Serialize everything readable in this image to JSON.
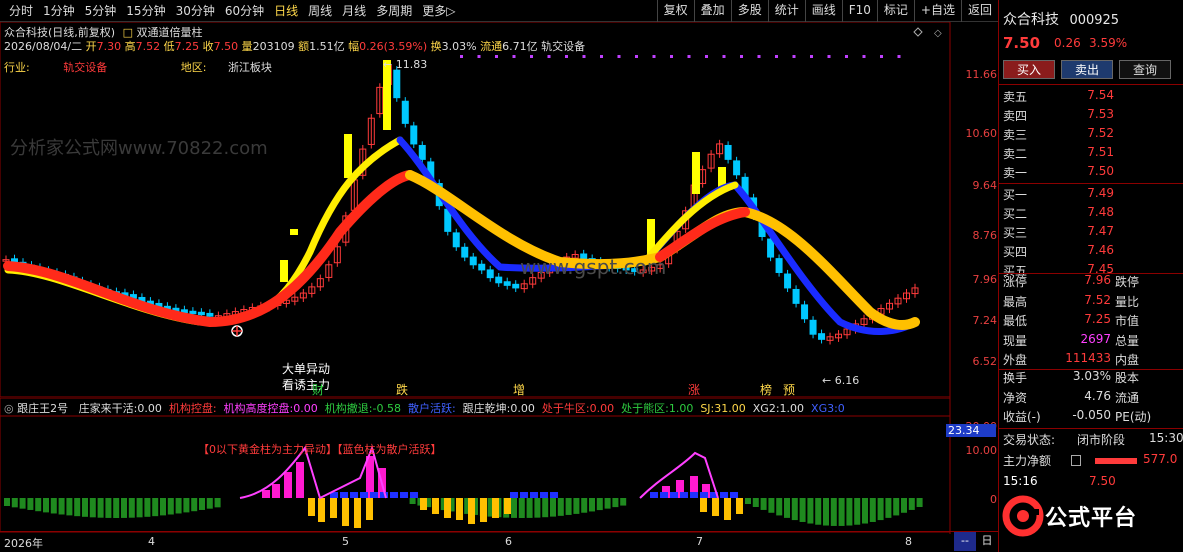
{
  "toolbar": {
    "periods": [
      "分时",
      "1分钟",
      "5分钟",
      "15分钟",
      "30分钟",
      "60分钟",
      "日线",
      "周线",
      "月线",
      "多周期",
      "更多▷"
    ],
    "active_period": "日线",
    "buttons": [
      "复权",
      "叠加",
      "多股",
      "统计",
      "画线",
      "F10",
      "标记",
      "+自选",
      "返回"
    ]
  },
  "main_info": {
    "stock_label": "众合科技(日线,前复权)",
    "indicator_label": "双通道倍量柱",
    "date": "2026/08/04/二",
    "open_lbl": "开",
    "open": "7.30",
    "high_lbl": "高",
    "high": "7.52",
    "low_lbl": "低",
    "low": "7.25",
    "close_lbl": "收",
    "close": "7.50",
    "vol_lbl": "量",
    "vol": "203109",
    "amt_lbl": "额",
    "amt": "1.51亿",
    "amp_lbl": "幅",
    "amp": "0.26(3.59%)",
    "turn_lbl": "换",
    "turn": "3.03%",
    "float_lbl": "流通",
    "float": "6.71亿",
    "sector": "轨交设备",
    "industry_lbl": "行业:",
    "industry": "轨交设备",
    "region_lbl": "地区:",
    "region": "浙江板块"
  },
  "price_ticks": [
    "11.66",
    "10.60",
    "9.64",
    "8.76",
    "7.96",
    "7.24",
    "6.52"
  ],
  "annotations": {
    "high_mark": "11.83",
    "low_mark": "6.16",
    "big_order": "大单异动",
    "lure": "看诱主力",
    "labels": [
      "财",
      "跌",
      "增",
      "涨",
      "榜",
      "预"
    ]
  },
  "sub_info": {
    "name": "跟庄王2号",
    "items": [
      {
        "k": "庄家来干活:",
        "v": "0.00",
        "color": "#dddddd"
      },
      {
        "k": "机构控盘:",
        "v": "",
        "color": "#ff3b3b"
      },
      {
        "k": "机构高度控盘:",
        "v": "0.00",
        "color": "#ff40ff"
      },
      {
        "k": "机构撤退:",
        "v": "-0.58",
        "color": "#2ecc40"
      },
      {
        "k": "散户活跃:",
        "v": "",
        "color": "#4060ff"
      },
      {
        "k": "跟庄乾坤:",
        "v": "0.00",
        "color": "#dddddd"
      },
      {
        "k": "处于牛区:",
        "v": "0.00",
        "color": "#ff3b3b"
      },
      {
        "k": "处于熊区:",
        "v": "1.00",
        "color": "#2ecc40"
      },
      {
        "k": "SJ:",
        "v": "31.00",
        "color": "#ffd84a"
      },
      {
        "k": "XG2:",
        "v": "1.00",
        "color": "#dddddd"
      },
      {
        "k": "XG3:",
        "v": "0",
        "color": "#4060ff"
      }
    ],
    "note": "【0以下黄金柱为主力异动】【蓝色柱为散户活跃】",
    "ticks": [
      "20.00",
      "10.00",
      "0"
    ],
    "current": "23.34"
  },
  "date_axis": {
    "labels": [
      "2026年",
      "4",
      "5",
      "6",
      "7",
      "8"
    ],
    "right_btns": [
      "--",
      "日"
    ]
  },
  "panel": {
    "name": "众合科技",
    "code": "000925",
    "price": "7.50",
    "change": "0.26",
    "pct": "3.59%",
    "buttons": {
      "buy": "买入",
      "sell": "卖出",
      "query": "查询"
    },
    "asks": [
      {
        "label": "卖五",
        "price": "7.54"
      },
      {
        "label": "卖四",
        "price": "7.53"
      },
      {
        "label": "卖三",
        "price": "7.52"
      },
      {
        "label": "卖二",
        "price": "7.51"
      },
      {
        "label": "卖一",
        "price": "7.50"
      }
    ],
    "bids": [
      {
        "label": "买一",
        "price": "7.49"
      },
      {
        "label": "买二",
        "price": "7.48"
      },
      {
        "label": "买三",
        "price": "7.47"
      },
      {
        "label": "买四",
        "price": "7.46"
      },
      {
        "label": "买五",
        "price": "7.45"
      }
    ],
    "stats": [
      {
        "l1": "涨停",
        "v1": "7.96",
        "c1": "#ff3b3b",
        "l2": "跌停"
      },
      {
        "l1": "最高",
        "v1": "7.52",
        "c1": "#ff3b3b",
        "l2": "量比"
      },
      {
        "l1": "最低",
        "v1": "7.25",
        "c1": "#ff3b3b",
        "l2": "市值"
      },
      {
        "l1": "现量",
        "v1": "2697",
        "c1": "#ff40ff",
        "l2": "总量"
      },
      {
        "l1": "外盘",
        "v1": "111433",
        "c1": "#ff3b3b",
        "l2": "内盘"
      }
    ],
    "stats2": [
      {
        "l1": "换手",
        "v1": "3.03%",
        "c1": "#dddddd",
        "l2": "股本"
      },
      {
        "l1": "净资",
        "v1": "4.76",
        "c1": "#dddddd",
        "l2": "流通"
      },
      {
        "l1": "收益(-)",
        "v1": "-0.050",
        "c1": "#dddddd",
        "l2": "PE(动)"
      }
    ],
    "trade_state_lbl": "交易状态:",
    "trade_state": "闭市阶段",
    "trade_time": "15:30",
    "main_flow_lbl": "主力净额",
    "main_flow": "577.0",
    "tick_time": "15:16",
    "tick_price": "7.50",
    "logo_text": "公式平台"
  },
  "colors": {
    "up": "#ff3b3b",
    "down": "#00c8ff",
    "yellow": "#ffd84a",
    "ema_fast": "#ffff00",
    "ema_slow": "#ff2a1a",
    "ema_fast_down": "#1a2bff",
    "ema_slow_down": "#ffc000"
  }
}
